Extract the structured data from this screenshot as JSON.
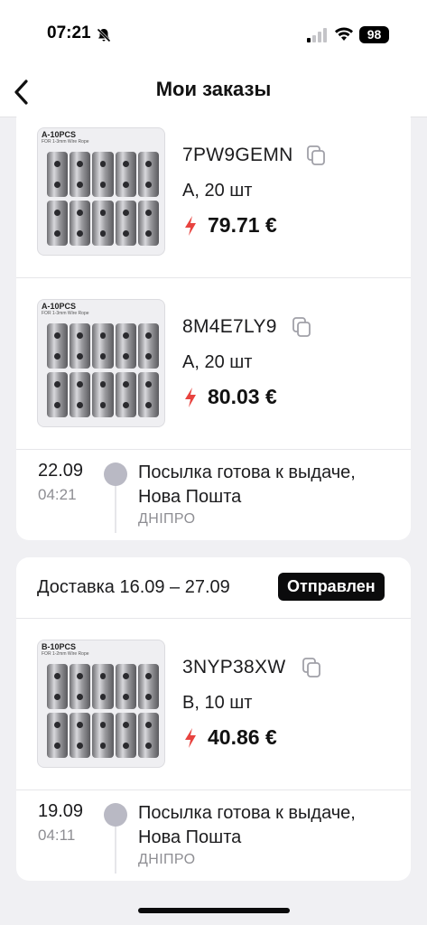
{
  "status_bar": {
    "time": "07:21",
    "battery": "98"
  },
  "nav": {
    "title": "Мои заказы"
  },
  "orders_group_1": {
    "items": [
      {
        "thumb_title": "A-10PCS",
        "thumb_sub": "FOR 1-3mm Wire Rope",
        "code": "7PW9GEMN",
        "variant": "A, 20 шт",
        "price": "79.71 €"
      },
      {
        "thumb_title": "A-10PCS",
        "thumb_sub": "FOR 1-3mm Wire Rope",
        "code": "8M4E7LY9",
        "variant": "A, 20 шт",
        "price": "80.03 €"
      }
    ],
    "tracking": {
      "date": "22.09",
      "time": "04:21",
      "status": "Посылка готова к выдаче, Нова Пошта",
      "city": "ДНІПРО"
    }
  },
  "orders_group_2": {
    "delivery": "Доставка 16.09 – 27.09",
    "badge": "Отправлен",
    "items": [
      {
        "thumb_title": "B-10PCS",
        "thumb_sub": "FOR 1-2mm Wire Rope",
        "code": "3NYP38XW",
        "variant": "B, 10 шт",
        "price": "40.86 €"
      }
    ],
    "tracking": {
      "date": "19.09",
      "time": "04:11",
      "status": "Посылка готова к выдаче, Нова Пошта",
      "city": "ДНІПРО"
    }
  },
  "colors": {
    "accent_bolt": "#e8433f",
    "badge_bg": "#0b0b0c",
    "timeline_dot": "#b9b9c4"
  },
  "icons": [
    "bell-slash-icon",
    "signal-icon",
    "wifi-icon",
    "chevron-left-icon",
    "copy-icon",
    "lightning-icon"
  ]
}
